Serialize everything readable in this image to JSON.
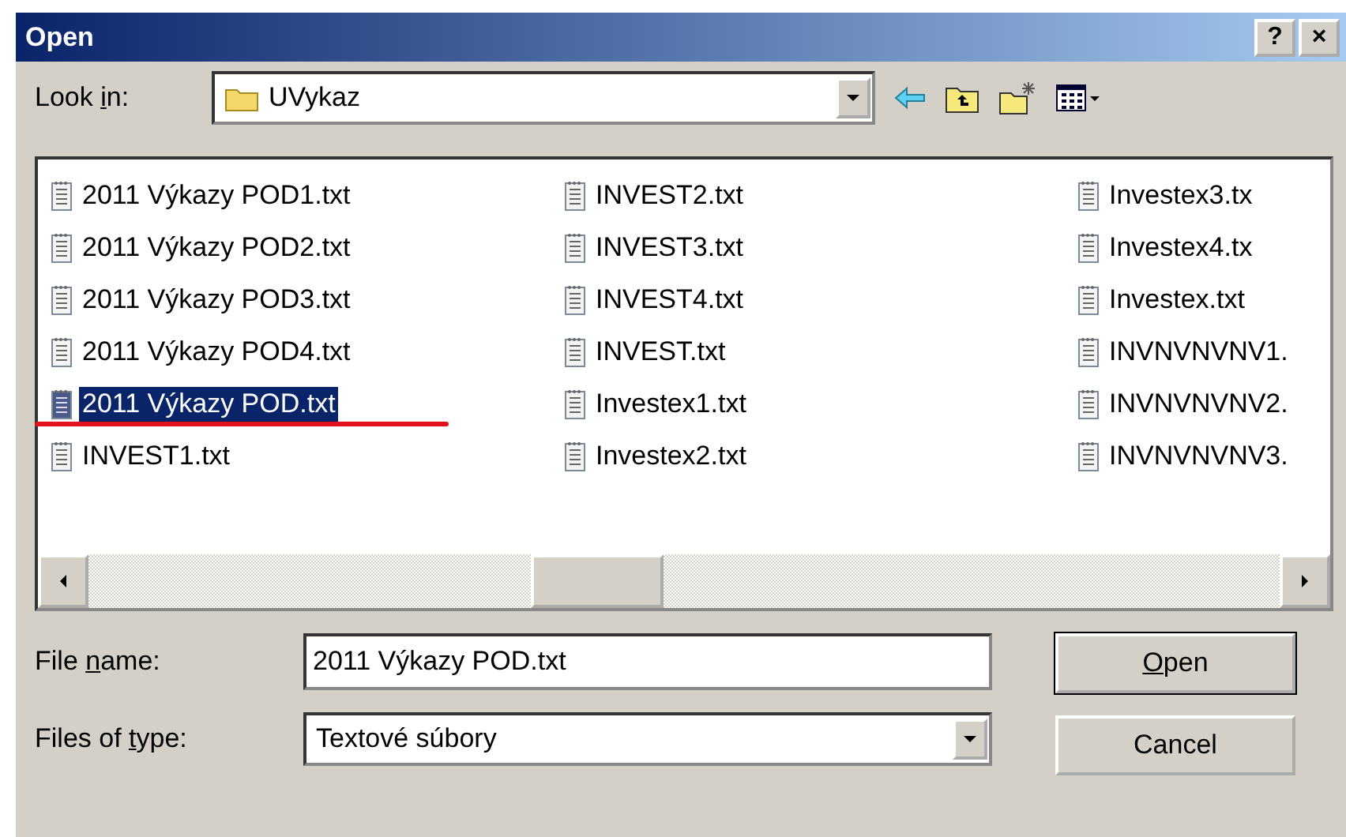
{
  "window": {
    "title": "Open",
    "buttons": [
      "?",
      "×"
    ]
  },
  "look_in": {
    "label": {
      "before": "Look ",
      "key": "i",
      "after": "n:"
    },
    "value": "UVykaz"
  },
  "files": [
    [
      {
        "name": "2011 Výkazy POD1.txt",
        "selected": false
      },
      {
        "name": "2011 Výkazy POD2.txt",
        "selected": false
      },
      {
        "name": "2011 Výkazy POD3.txt",
        "selected": false
      },
      {
        "name": "2011 Výkazy POD4.txt",
        "selected": false
      },
      {
        "name": "2011 Výkazy POD.txt",
        "selected": true
      },
      {
        "name": "INVEST1.txt",
        "selected": false
      }
    ],
    [
      {
        "name": "INVEST2.txt",
        "selected": false
      },
      {
        "name": "INVEST3.txt",
        "selected": false
      },
      {
        "name": "INVEST4.txt",
        "selected": false
      },
      {
        "name": "INVEST.txt",
        "selected": false
      },
      {
        "name": "Investex1.txt",
        "selected": false
      },
      {
        "name": "Investex2.txt",
        "selected": false
      }
    ],
    [
      {
        "name": "Investex3.tx",
        "selected": false
      },
      {
        "name": "Investex4.tx",
        "selected": false
      },
      {
        "name": "Investex.txt",
        "selected": false
      },
      {
        "name": "INVNVNVNV1.",
        "selected": false
      },
      {
        "name": "INVNVNVNV2.",
        "selected": false
      },
      {
        "name": "INVNVNVNV3.",
        "selected": false
      }
    ]
  ],
  "file_name": {
    "label": {
      "before": "File ",
      "key": "n",
      "after": "ame:"
    },
    "value": "2011 Výkazy POD.txt"
  },
  "file_type": {
    "label": {
      "before": "Files of ",
      "key": "t",
      "after": "ype:"
    },
    "value": "Textové súbory"
  },
  "open_button": {
    "key": "O",
    "after": "pen"
  },
  "cancel_button": "Cancel"
}
